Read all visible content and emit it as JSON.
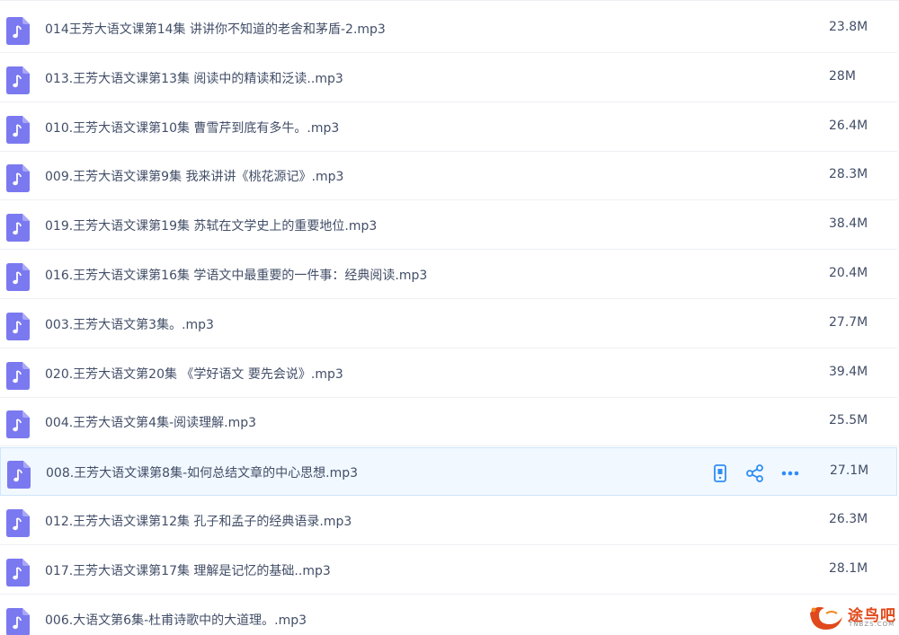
{
  "files": [
    {
      "name": "014王芳大语文课第14集 讲讲你不知道的老舍和茅盾-2.mp3",
      "size": "23.8M",
      "icon": "music-file-icon"
    },
    {
      "name": "013.王芳大语文课第13集 阅读中的精读和泛读..mp3",
      "size": "28M",
      "icon": "music-file-icon"
    },
    {
      "name": "010.王芳大语文课第10集 曹雪芹到底有多牛。.mp3",
      "size": "26.4M",
      "icon": "music-file-icon"
    },
    {
      "name": "009.王芳大语文课第9集 我来讲讲《桃花源记》.mp3",
      "size": "28.3M",
      "icon": "music-file-icon"
    },
    {
      "name": "019.王芳大语文课第19集 苏轼在文学史上的重要地位.mp3",
      "size": "38.4M",
      "icon": "music-file-icon"
    },
    {
      "name": "016.王芳大语文课第16集 学语文中最重要的一件事：经典阅读.mp3",
      "size": "20.4M",
      "icon": "music-file-icon"
    },
    {
      "name": "003.王芳大语文第3集。.mp3",
      "size": "27.7M",
      "icon": "music-file-icon"
    },
    {
      "name": "020.王芳大语文第20集 《学好语文 要先会说》.mp3",
      "size": "39.4M",
      "icon": "music-file-icon"
    },
    {
      "name": "004.王芳大语文第4集-阅读理解.mp3",
      "size": "25.5M",
      "icon": "music-file-icon"
    },
    {
      "name": "008.王芳大语文课第8集-如何总结文章的中心思想.mp3",
      "size": "27.1M",
      "icon": "music-file-icon"
    },
    {
      "name": "012.王芳大语文课第12集 孔子和孟子的经典语录.mp3",
      "size": "26.3M",
      "icon": "music-file-icon"
    },
    {
      "name": "017.王芳大语文课第17集 理解是记忆的基础..mp3",
      "size": "28.1M",
      "icon": "music-file-icon"
    },
    {
      "name": "006.大语文第6集-杜甫诗歌中的大道理。.mp3",
      "size": "",
      "icon": "music-file-icon"
    }
  ],
  "hovered_row_index": 9,
  "hover_actions": [
    "phone-icon",
    "share-icon",
    "more-icon"
  ],
  "watermark": {
    "text": "途鸟吧",
    "subtext": "TNBZS.COM"
  },
  "colors": {
    "file_icon": "#7b79f0",
    "action_icon": "#2f8df5",
    "text": "#424e67",
    "hover_bg": "#f1f8ff",
    "watermark": "#e0491b"
  }
}
